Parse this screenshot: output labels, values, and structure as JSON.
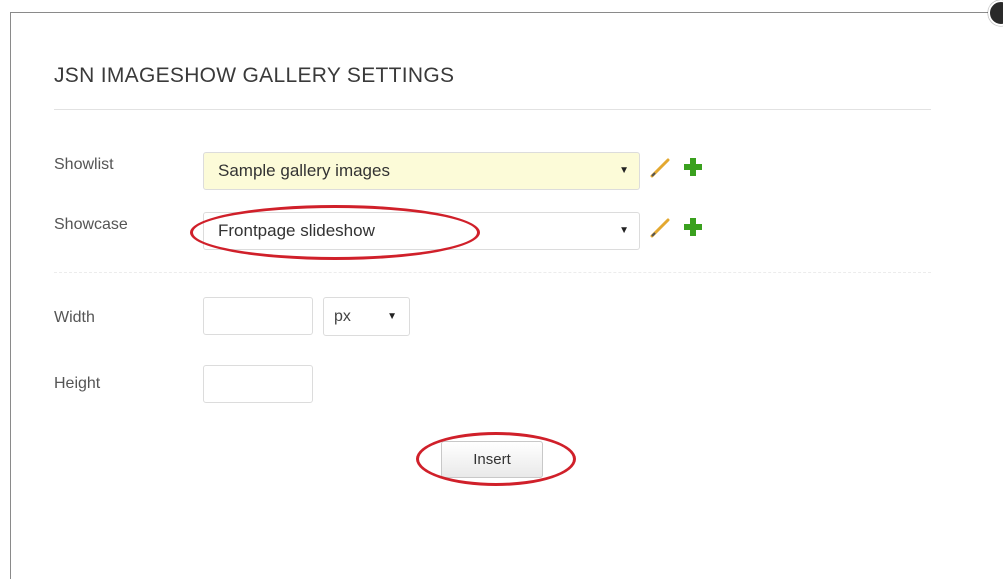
{
  "dialog": {
    "title": "JSN IMAGESHOW GALLERY SETTINGS"
  },
  "showlist": {
    "label": "Showlist",
    "selected": "Sample gallery images",
    "edit_icon": "pencil-icon",
    "add_icon": "plus-icon"
  },
  "showcase": {
    "label": "Showcase",
    "selected": "Frontpage slideshow",
    "edit_icon": "pencil-icon",
    "add_icon": "plus-icon"
  },
  "width": {
    "label": "Width",
    "value": "",
    "unit": "px"
  },
  "height": {
    "label": "Height",
    "value": ""
  },
  "actions": {
    "insert_label": "Insert"
  },
  "colors": {
    "annotation": "#d0202a",
    "highlight_bg": "#fcfbd8",
    "add_icon": "#3aa01e",
    "edit_icon": "#e3a830"
  }
}
